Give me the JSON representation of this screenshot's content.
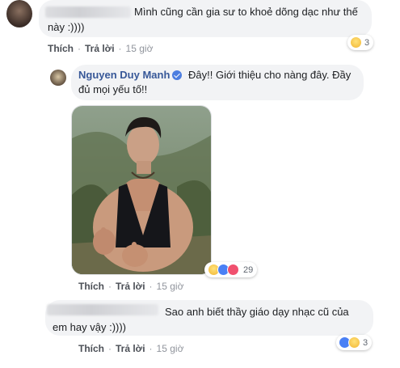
{
  "comment1": {
    "text_line1": "Mình cũng cần gia sư to khoẻ dõng dạc như thế",
    "text_line2": "này :))))",
    "reaction_count": "3"
  },
  "comment2": {
    "author": "Nguyen Duy Manh",
    "text_line1": "Đây!! Giới thiệu cho nàng đây. Đầy",
    "text_line2": "đủ mọi yếu tố!!",
    "reaction_count": "29"
  },
  "comment3": {
    "text_line1": "Sao anh biết thầy giáo dạy nhạc cũ của",
    "text_line2": "em hay vậy :))))",
    "reaction_count": "3"
  },
  "actions": {
    "like": "Thích",
    "reply": "Trả lời",
    "time": "15 giờ",
    "separator": "·"
  },
  "colors": {
    "author_link": "#385898",
    "bubble_bg": "#f2f3f5",
    "like_blue": "#4a80f5",
    "love_red": "#f0506e",
    "haha_yellow": "#f7c948"
  },
  "icons": [
    "haha-icon",
    "like-reaction-icon",
    "love-reaction-icon",
    "verified-badge-icon"
  ]
}
